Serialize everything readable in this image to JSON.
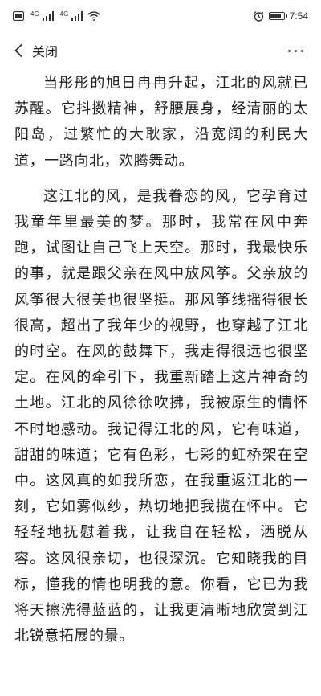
{
  "status_bar": {
    "time": "7:54",
    "signal_label_1": "4G",
    "signal_label_2": "4G",
    "battery_level": 0.85
  },
  "header": {
    "back_label": "关闭"
  },
  "article": {
    "paragraphs": [
      "当彤彤的旭日冉冉升起，江北的风就已苏醒。它抖擞精神，舒腰展身，经清丽的太阳岛，过繁忙的大耿家，沿宽阔的利民大道，一路向北，欢腾舞动。",
      "这江北的风，是我眷恋的风，它孕育过我童年里最美的梦。那时，我常在风中奔跑，试图让自己飞上天空。那时，我最快乐的事，就是跟父亲在风中放风筝。父亲放的风筝很大很美也很坚挺。那风筝线摇得很长很高，超出了我年少的视野，也穿越了江北的时空。在风的鼓舞下，我走得很远也很坚定。在风的牵引下，我重新踏上这片神奇的土地。江北的风徐徐吹拂，我被原生的情怀不时地感动。我记得江北的风，它有味道，甜甜的味道；它有色彩，七彩的虹桥架在空中。这风真的如我所恋，在我重返江北的一刻，它如雾似纱，热切地把我揽在怀中。它轻轻地抚慰着我，让我自在轻松，洒脱从容。这风很亲切，也很深沉。它知晓我的目标，懂我的情也明我的意。你看，它已为我将天擦洗得蓝蓝的，让我更清晰地欣赏到江北锐意拓展的景。"
    ]
  }
}
